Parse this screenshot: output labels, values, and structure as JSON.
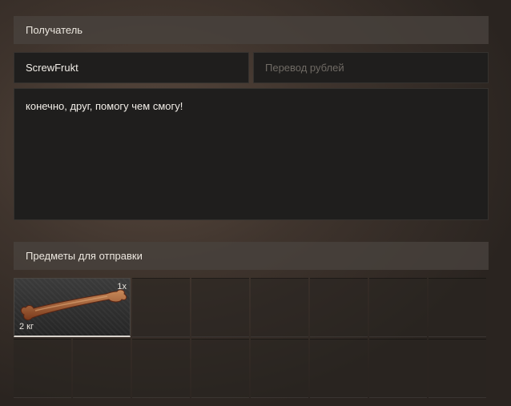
{
  "recipient_section": {
    "title": "Получатель"
  },
  "recipient": {
    "name_value": "ScrewFrukt",
    "transfer_placeholder": "Перевод рублей"
  },
  "message": {
    "value": "конечно, друг, помогу чем смогу!"
  },
  "items_section": {
    "title": "Предметы для отправки"
  },
  "items": [
    {
      "icon": "bone-icon",
      "quantity": "1x",
      "weight": "2 кг"
    }
  ],
  "grid": {
    "columns": 8,
    "visible_rows": 2
  }
}
